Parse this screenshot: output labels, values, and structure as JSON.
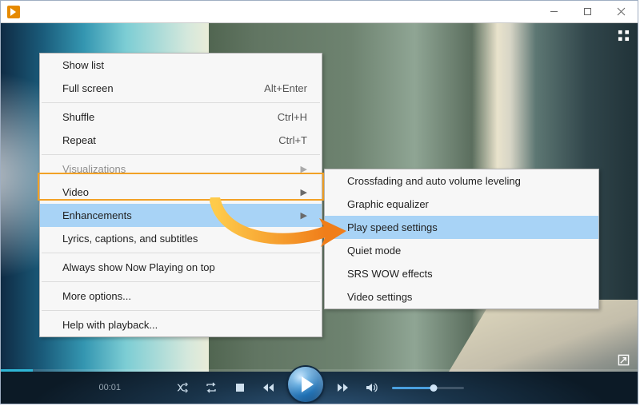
{
  "window": {
    "title": ""
  },
  "menu": {
    "items": [
      {
        "label": "Show list",
        "shortcut": "",
        "submenu": false
      },
      {
        "label": "Full screen",
        "shortcut": "Alt+Enter",
        "submenu": false
      },
      {
        "sep": true
      },
      {
        "label": "Shuffle",
        "shortcut": "Ctrl+H",
        "submenu": false
      },
      {
        "label": "Repeat",
        "shortcut": "Ctrl+T",
        "submenu": false
      },
      {
        "sep": true
      },
      {
        "label": "Visualizations",
        "shortcut": "",
        "submenu": true,
        "disabled": true
      },
      {
        "label": "Video",
        "shortcut": "",
        "submenu": true
      },
      {
        "label": "Enhancements",
        "shortcut": "",
        "submenu": true,
        "selected": true
      },
      {
        "label": "Lyrics, captions, and subtitles",
        "shortcut": "",
        "submenu": true
      },
      {
        "sep": true
      },
      {
        "label": "Always show Now Playing on top",
        "shortcut": "",
        "submenu": false
      },
      {
        "sep": true
      },
      {
        "label": "More options...",
        "shortcut": "",
        "submenu": false
      },
      {
        "sep": true
      },
      {
        "label": "Help with playback...",
        "shortcut": "",
        "submenu": false
      }
    ]
  },
  "submenu": {
    "items": [
      {
        "label": "Crossfading and auto volume leveling"
      },
      {
        "label": "Graphic equalizer"
      },
      {
        "label": "Play speed settings",
        "selected": true
      },
      {
        "label": "Quiet mode"
      },
      {
        "label": "SRS WOW effects"
      },
      {
        "label": "Video settings"
      }
    ]
  },
  "player": {
    "time": "00:01"
  },
  "colors": {
    "highlight": "#a8d3f6",
    "outline": "#f2a126"
  }
}
